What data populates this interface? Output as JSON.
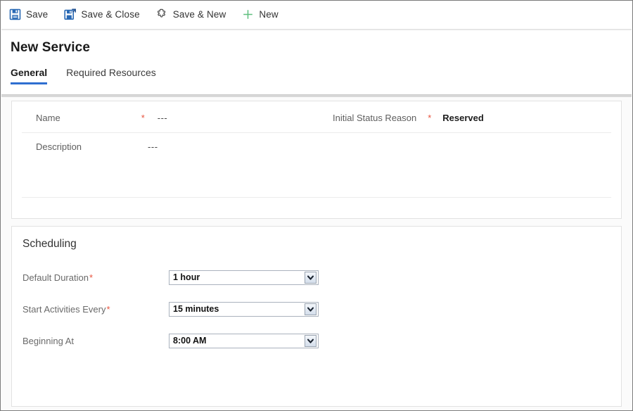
{
  "window": {
    "title": "New Service"
  },
  "commandbar": {
    "buttons": [
      {
        "label": "Save",
        "icon": "save-icon"
      },
      {
        "label": "Save & Close",
        "icon": "save-and-close-icon"
      },
      {
        "label": "Save & New",
        "icon": "save-and-new-icon"
      },
      {
        "label": "New",
        "icon": "plus-icon"
      }
    ]
  },
  "tabs": [
    {
      "label": "General",
      "active": true
    },
    {
      "label": "Required Resources",
      "active": false
    }
  ],
  "general": {
    "fields": [
      {
        "label": "Name",
        "required": true,
        "value": "---"
      },
      {
        "label": "Initial Status Reason",
        "required": true,
        "value": "Reserved"
      },
      {
        "label": "Description",
        "required": false,
        "value": "---"
      }
    ],
    "required_marker": "*"
  },
  "scheduling": {
    "title": "Scheduling",
    "fields": [
      {
        "label": "Default Duration",
        "required": true,
        "value": "1 hour"
      },
      {
        "label": "Start Activities Every",
        "required": true,
        "value": "15 minutes"
      },
      {
        "label": "Beginning At",
        "required": false,
        "value": "8:00 AM"
      }
    ]
  },
  "colors": {
    "accent": "#2f6fd0",
    "required": "#e8543f",
    "save_icon": "#2a6ab5",
    "new_icon": "#5fbf7f",
    "panel_border": "#e2e2e2"
  }
}
